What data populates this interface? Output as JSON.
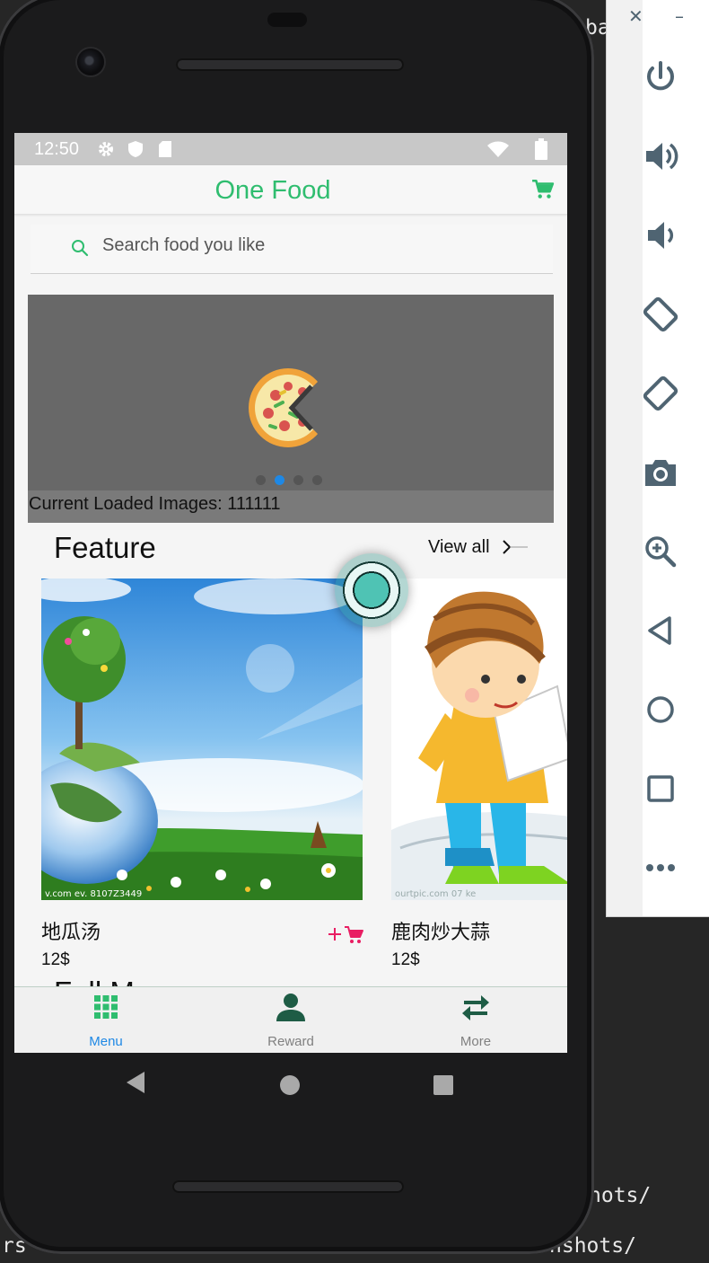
{
  "terminal": {
    "line1": "ba",
    "line2": "hots/",
    "line3_left": "rs",
    "line3_right": "nshots/"
  },
  "emulator_toolbar": {
    "window_buttons": [
      "close-icon",
      "minimize-icon"
    ],
    "buttons": [
      "power-icon",
      "volume-up-icon",
      "volume-down-icon",
      "rotate-left-icon",
      "rotate-right-icon",
      "camera-icon",
      "zoom-in-icon",
      "back-icon",
      "home-icon",
      "overview-icon",
      "more-icon"
    ],
    "icon_color": "#4f6472"
  },
  "status_bar": {
    "time": "12:50",
    "icons": [
      "settings-icon",
      "shield-icon",
      "sd-card-icon",
      "wifi-icon",
      "battery-icon"
    ]
  },
  "app_bar": {
    "title": "One Food",
    "accent_color": "#2fbd6f",
    "cart_icon": "cart-icon"
  },
  "search": {
    "placeholder": "Search food you like",
    "icon": "search-icon"
  },
  "banner": {
    "caption": "Current Loaded Images: 111111",
    "dot_count": 4,
    "active_dot": 1,
    "active_color": "#1e88e5"
  },
  "feature": {
    "title": "Feature",
    "view_all": "View all",
    "items": [
      {
        "name": "地瓜汤",
        "price": "12$",
        "watermark": "v.com  ev. 8107Z3449"
      },
      {
        "name": "鹿肉炒大蒜",
        "price": "12$",
        "watermark": "ourtpic.com   07   ke"
      }
    ]
  },
  "full_menu": {
    "title": "Full Menu"
  },
  "bottom_nav": {
    "items": [
      {
        "label": "Menu",
        "icon": "grid-icon",
        "active": true
      },
      {
        "label": "Reward",
        "icon": "person-icon",
        "active": false
      },
      {
        "label": "More",
        "icon": "swap-arrows-icon",
        "active": false
      }
    ]
  }
}
